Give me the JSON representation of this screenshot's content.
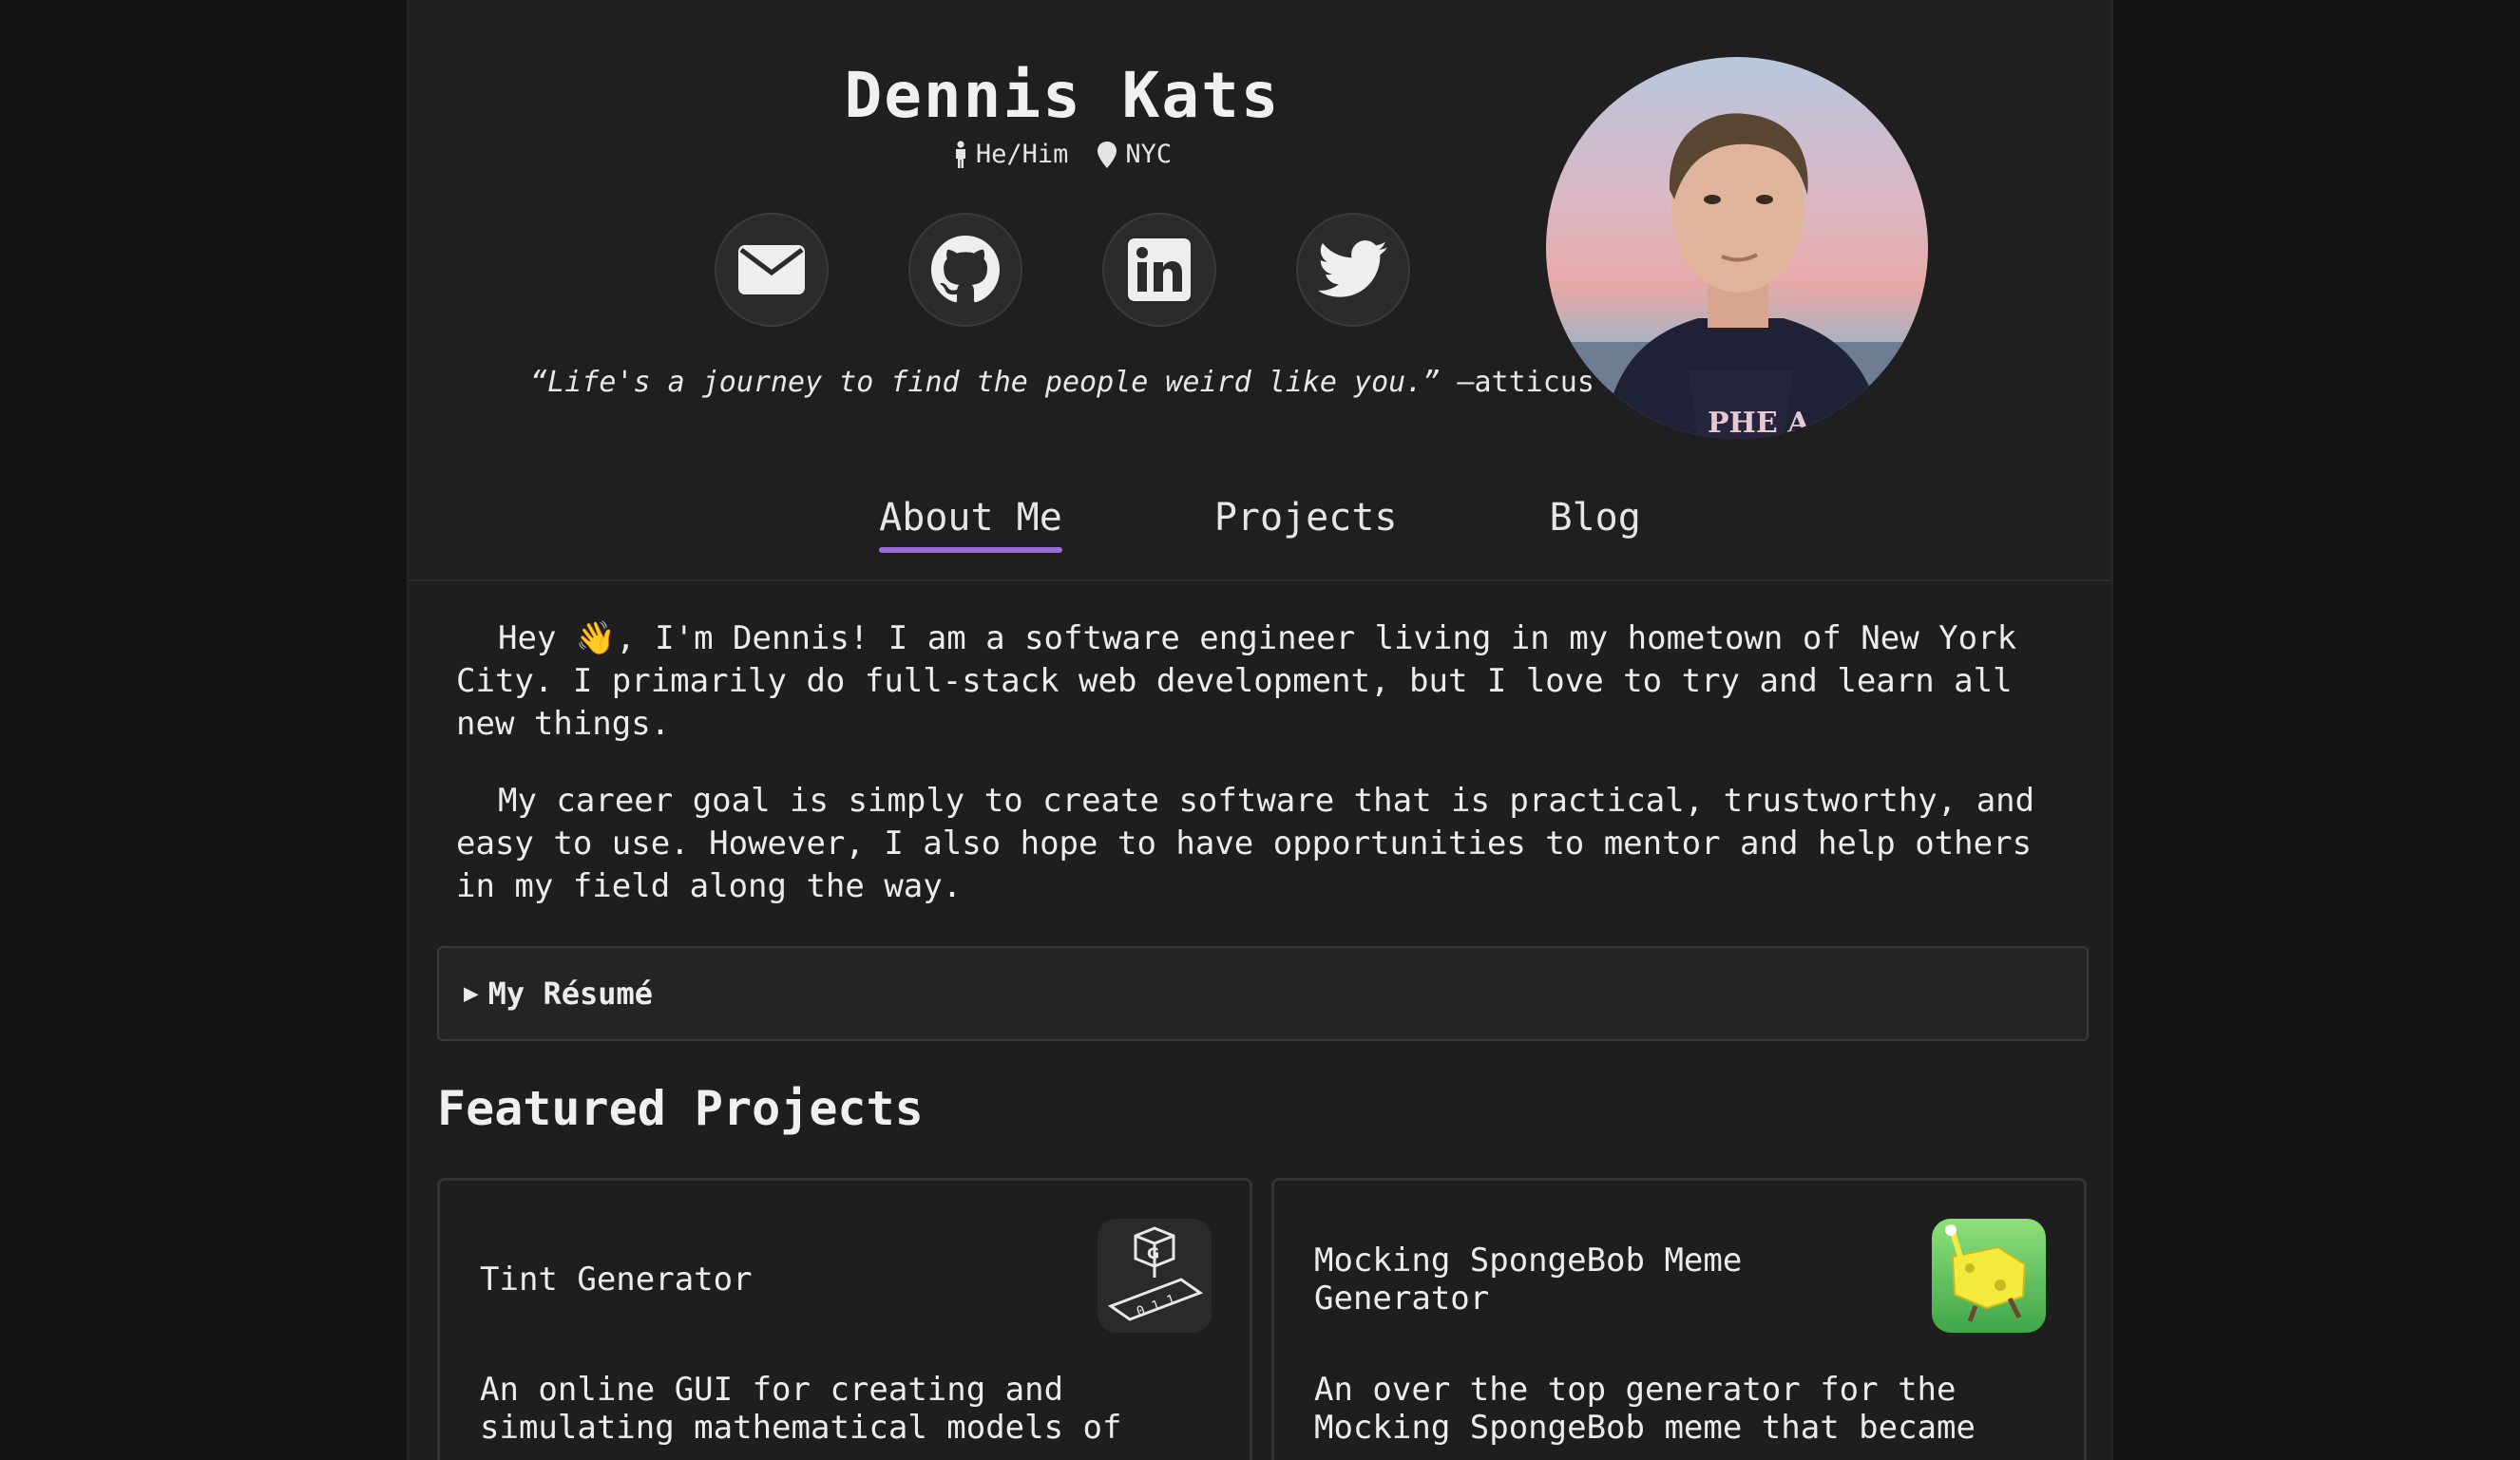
{
  "profile": {
    "name": "Dennis Kats",
    "pronouns": "He/Him",
    "location": "NYC",
    "quote_text": "“Life's a journey to find the people weird like you.”",
    "quote_author": "—atticus"
  },
  "socials": [
    {
      "label": "email",
      "icon": "envelope-icon"
    },
    {
      "label": "github",
      "icon": "github-icon"
    },
    {
      "label": "linkedin",
      "icon": "linkedin-icon"
    },
    {
      "label": "twitter",
      "icon": "twitter-icon"
    }
  ],
  "tabs": [
    {
      "label": "About Me",
      "active": true
    },
    {
      "label": "Projects",
      "active": false
    },
    {
      "label": "Blog",
      "active": false
    }
  ],
  "about": {
    "paragraph_1": "Hey 👋, I'm Dennis! I am a software engineer living in my hometown of New York City. I primarily do full-stack web development, but I love to try and learn all new things.",
    "paragraph_2": "My career goal is simply to create software that is practical, trustworthy, and easy to use. However, I also hope to have opportunities to mentor and help others in my field along the way."
  },
  "resume": {
    "label": "My Résumé"
  },
  "featured": {
    "title": "Featured Projects",
    "projects": [
      {
        "title": "Tint Generator",
        "description": "An online GUI for creating and simulating mathematical models of"
      },
      {
        "title": "Mocking SpongeBob Meme Generator",
        "description": "An over the top generator for the Mocking SpongeBob meme that became"
      }
    ]
  },
  "colors": {
    "background": "#141414",
    "panel": "#1e1e1e",
    "accent_underline": "#9b6bdc"
  }
}
